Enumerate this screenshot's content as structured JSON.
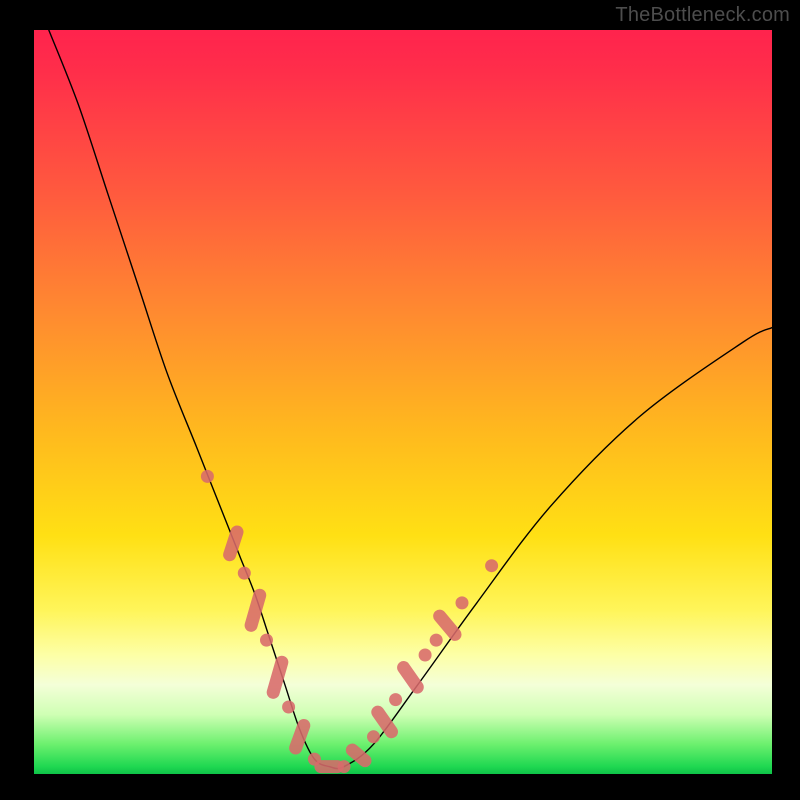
{
  "watermark": "TheBottleneck.com",
  "colors": {
    "dot": "#d86a6b",
    "curve": "#000000"
  },
  "chart_data": {
    "type": "line",
    "title": "",
    "xlabel": "",
    "ylabel": "",
    "xlim": [
      0,
      100
    ],
    "ylim": [
      0,
      100
    ],
    "grid": false,
    "series": [
      {
        "name": "bottleneck-curve",
        "x": [
          2,
          6,
          10,
          14,
          18,
          22,
          26,
          28,
          30,
          32,
          34,
          36,
          38,
          40,
          42,
          46,
          52,
          60,
          70,
          82,
          96,
          100
        ],
        "values": [
          100,
          90,
          78,
          66,
          54,
          44,
          34,
          29,
          24,
          18,
          12,
          6,
          2,
          1,
          1,
          4,
          12,
          23,
          36,
          48,
          58,
          60
        ]
      }
    ],
    "markers": {
      "name": "highlight-segments",
      "note": "short pink pill/dot markers along the curve near the valley on both branches",
      "points": [
        {
          "x": 23.5,
          "y": 40,
          "shape": "dot"
        },
        {
          "x": 27,
          "y": 31,
          "shape": "pill",
          "angle": -72,
          "len": 5
        },
        {
          "x": 28.5,
          "y": 27,
          "shape": "dot"
        },
        {
          "x": 30,
          "y": 22,
          "shape": "pill",
          "angle": -74,
          "len": 6
        },
        {
          "x": 31.5,
          "y": 18,
          "shape": "dot"
        },
        {
          "x": 33,
          "y": 13,
          "shape": "pill",
          "angle": -74,
          "len": 6
        },
        {
          "x": 34.5,
          "y": 9,
          "shape": "dot"
        },
        {
          "x": 36,
          "y": 5,
          "shape": "pill",
          "angle": -70,
          "len": 5
        },
        {
          "x": 38,
          "y": 2,
          "shape": "dot"
        },
        {
          "x": 40,
          "y": 1,
          "shape": "pill",
          "angle": 0,
          "len": 4
        },
        {
          "x": 42,
          "y": 1,
          "shape": "dot"
        },
        {
          "x": 44,
          "y": 2.5,
          "shape": "pill",
          "angle": 40,
          "len": 4
        },
        {
          "x": 46,
          "y": 5,
          "shape": "dot"
        },
        {
          "x": 47.5,
          "y": 7,
          "shape": "pill",
          "angle": 55,
          "len": 5
        },
        {
          "x": 49,
          "y": 10,
          "shape": "dot"
        },
        {
          "x": 51,
          "y": 13,
          "shape": "pill",
          "angle": 55,
          "len": 5
        },
        {
          "x": 53,
          "y": 16,
          "shape": "dot"
        },
        {
          "x": 54.5,
          "y": 18,
          "shape": "dot"
        },
        {
          "x": 56,
          "y": 20,
          "shape": "pill",
          "angle": 50,
          "len": 5
        },
        {
          "x": 58,
          "y": 23,
          "shape": "dot"
        },
        {
          "x": 62,
          "y": 28,
          "shape": "dot"
        }
      ]
    }
  }
}
